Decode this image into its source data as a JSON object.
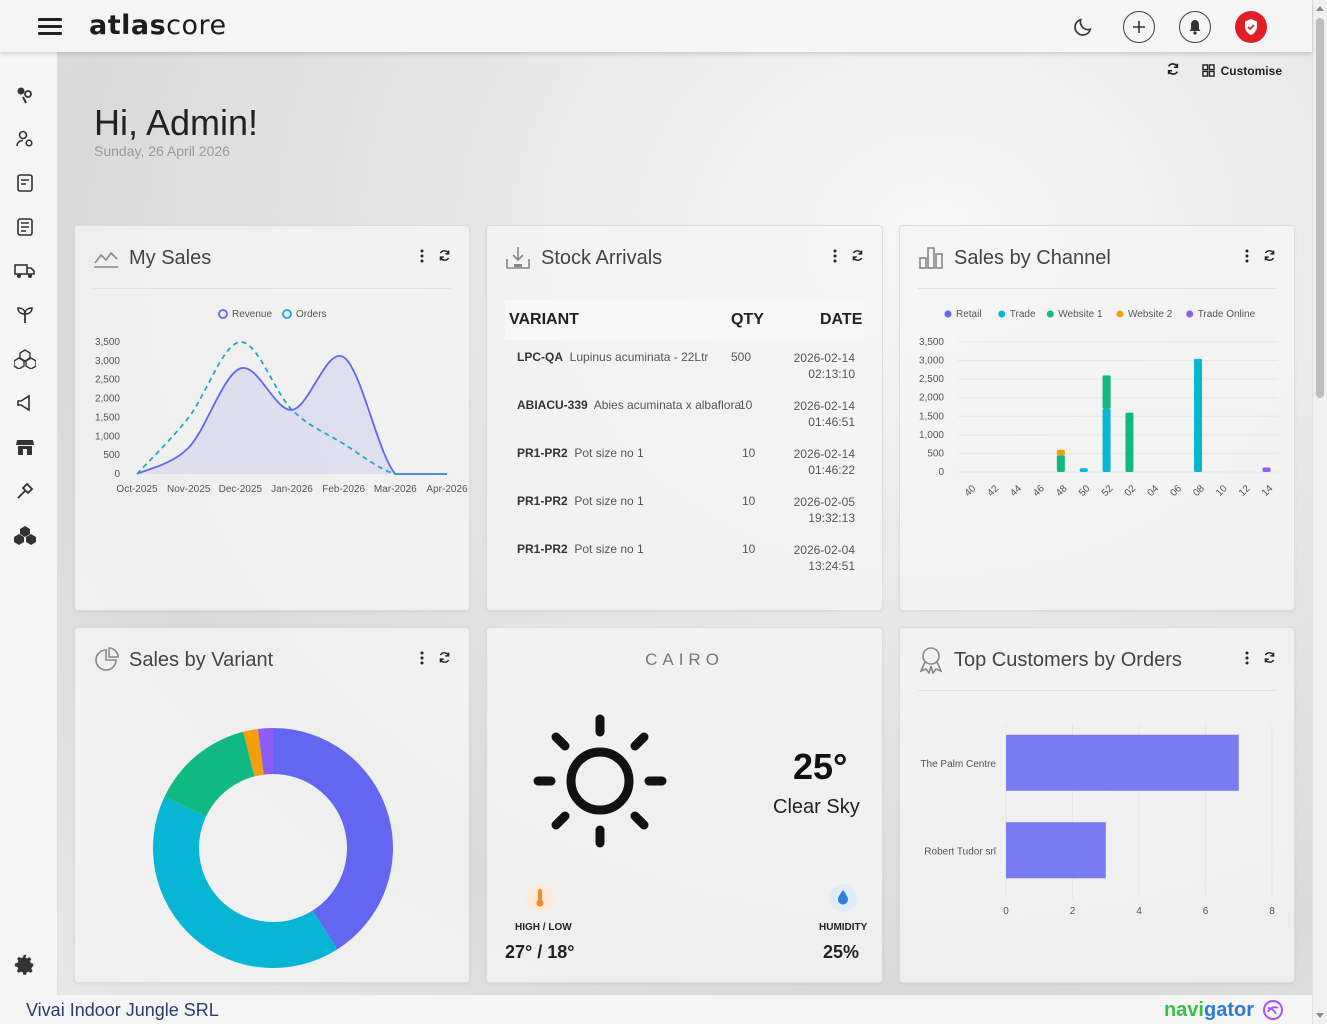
{
  "header": {
    "logo_bold": "atlas",
    "logo_light": "core"
  },
  "toolbar": {
    "customise_label": "Customise"
  },
  "greeting": {
    "title": "Hi, Admin!",
    "date": "Sunday, 26 April 2026"
  },
  "cards": {
    "my_sales": {
      "title": "My Sales"
    },
    "stock_arrivals": {
      "title": "Stock Arrivals",
      "columns": [
        "VARIANT",
        "QTY",
        "DATE"
      ],
      "rows": [
        {
          "sku": "LPC-QA",
          "name": "Lupinus acuminata - 22Ltr",
          "qty": "500",
          "date": "2026-02-14",
          "time": "02:13:10"
        },
        {
          "sku": "ABIACU-339",
          "name": "Abies acuminata x albaflora",
          "qty": "10",
          "date": "2026-02-14",
          "time": "01:46:51"
        },
        {
          "sku": "PR1-PR2",
          "name": "Pot size no 1",
          "qty": "10",
          "date": "2026-02-14",
          "time": "01:46:22"
        },
        {
          "sku": "PR1-PR2",
          "name": "Pot size no 1",
          "qty": "10",
          "date": "2026-02-05",
          "time": "19:32:13"
        },
        {
          "sku": "PR1-PR2",
          "name": "Pot size no 1",
          "qty": "10",
          "date": "2026-02-04",
          "time": "13:24:51"
        }
      ]
    },
    "sales_by_channel": {
      "title": "Sales by Channel"
    },
    "sales_by_variant": {
      "title": "Sales by Variant"
    },
    "weather": {
      "city": "CAIRO",
      "temperature": "25°",
      "condition": "Clear Sky",
      "high_low_label": "HIGH / LOW",
      "high_low_value": "27° / 18°",
      "humidity_label": "HUMIDITY",
      "humidity_value": "25%"
    },
    "top_customers": {
      "title": "Top Customers by Orders"
    }
  },
  "footer": {
    "company": "Vivai Indoor Jungle SRL",
    "brand_prefix": "navi",
    "brand_suffix": "gator"
  },
  "chart_data": [
    {
      "id": "my_sales",
      "type": "line",
      "title": "",
      "categories": [
        "Oct-2025",
        "Nov-2025",
        "Dec-2025",
        "Jan-2026",
        "Feb-2026",
        "Mar-2026",
        "Apr-2026"
      ],
      "ylim": [
        0,
        3500
      ],
      "yticks": [
        0,
        500,
        1000,
        1500,
        2000,
        2500,
        3000,
        3500
      ],
      "series": [
        {
          "name": "Revenue",
          "color": "#6366f1",
          "style": "solid-area",
          "values": [
            0,
            700,
            2800,
            1700,
            3100,
            0,
            0
          ]
        },
        {
          "name": "Orders",
          "color": "#1ea7c9",
          "style": "dashed",
          "values": [
            0,
            1500,
            3500,
            1700,
            800,
            0,
            0
          ]
        }
      ],
      "legend": "top-center"
    },
    {
      "id": "sales_by_channel",
      "type": "bar",
      "title": "",
      "categories": [
        "40",
        "42",
        "44",
        "46",
        "48",
        "50",
        "52",
        "02",
        "04",
        "06",
        "08",
        "10",
        "12",
        "14"
      ],
      "ylim": [
        0,
        3500
      ],
      "yticks": [
        0,
        500,
        1000,
        1500,
        2000,
        2500,
        3000,
        3500
      ],
      "series": [
        {
          "name": "Retail",
          "color": "#6366f1",
          "values": [
            0,
            0,
            0,
            0,
            0,
            0,
            0,
            0,
            0,
            0,
            0,
            0,
            0,
            0
          ]
        },
        {
          "name": "Trade",
          "color": "#06b6d4",
          "values": [
            0,
            0,
            0,
            0,
            0,
            100,
            1700,
            0,
            0,
            0,
            3050,
            0,
            0,
            0
          ]
        },
        {
          "name": "Website 1",
          "color": "#10b981",
          "values": [
            0,
            0,
            0,
            0,
            450,
            0,
            900,
            1600,
            0,
            0,
            0,
            0,
            0,
            0
          ]
        },
        {
          "name": "Website 2",
          "color": "#f59e0b",
          "values": [
            0,
            0,
            0,
            0,
            150,
            0,
            0,
            0,
            0,
            0,
            0,
            0,
            0,
            0
          ]
        },
        {
          "name": "Trade Online",
          "color": "#8b5cf6",
          "values": [
            0,
            0,
            0,
            0,
            0,
            0,
            0,
            0,
            0,
            0,
            0,
            0,
            0,
            120
          ]
        }
      ],
      "legend": "top-center"
    },
    {
      "id": "sales_by_variant",
      "type": "pie",
      "donut": true,
      "slices": [
        {
          "color": "#6366f1",
          "value": 41
        },
        {
          "color": "#06b6d4",
          "value": 41
        },
        {
          "color": "#10b981",
          "value": 14
        },
        {
          "color": "#f59e0b",
          "value": 2
        },
        {
          "color": "#8b5cf6",
          "value": 2
        }
      ]
    },
    {
      "id": "top_customers",
      "type": "bar",
      "orientation": "horizontal",
      "categories": [
        "The Palm Centre",
        "Robert Tudor srl"
      ],
      "values": [
        7,
        3
      ],
      "color": "#6366f1",
      "xlim": [
        0,
        8
      ],
      "xticks": [
        0,
        2,
        4,
        6,
        8
      ]
    }
  ]
}
